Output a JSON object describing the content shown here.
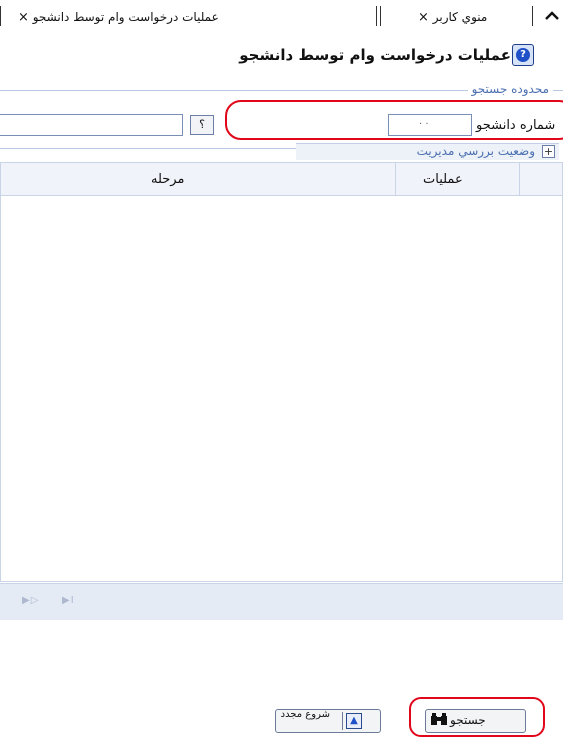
{
  "tabs": [
    {
      "label": "عملیات درخواست وام توسط دانشجو",
      "close": "×"
    },
    {
      "label": "منوي كاربر",
      "close": "×"
    }
  ],
  "home_icon": "home-caret-icon",
  "page": {
    "title": "عملیات درخواست وام توسط دانشجو",
    "help_icon": "help-icon"
  },
  "search_range": {
    "legend": "محدوده جستجو",
    "student_number_label": "شماره دانشجو",
    "student_number_value": ". .",
    "lookup_label": "؟"
  },
  "management_status": {
    "label": "وضعیت بررسي مدیریت",
    "toggle": "+"
  },
  "grid": {
    "columns": [
      "عملیات",
      "مرحله"
    ]
  },
  "pager": {
    "next": "▶▷",
    "last": "▶I"
  },
  "buttons": {
    "search_label": "جستجو",
    "restart_label": "شروع مجدد"
  },
  "colors": {
    "annotation_red": "#e1061a",
    "accent_blue": "#2050c8",
    "grid_border": "#c9d4e7"
  }
}
